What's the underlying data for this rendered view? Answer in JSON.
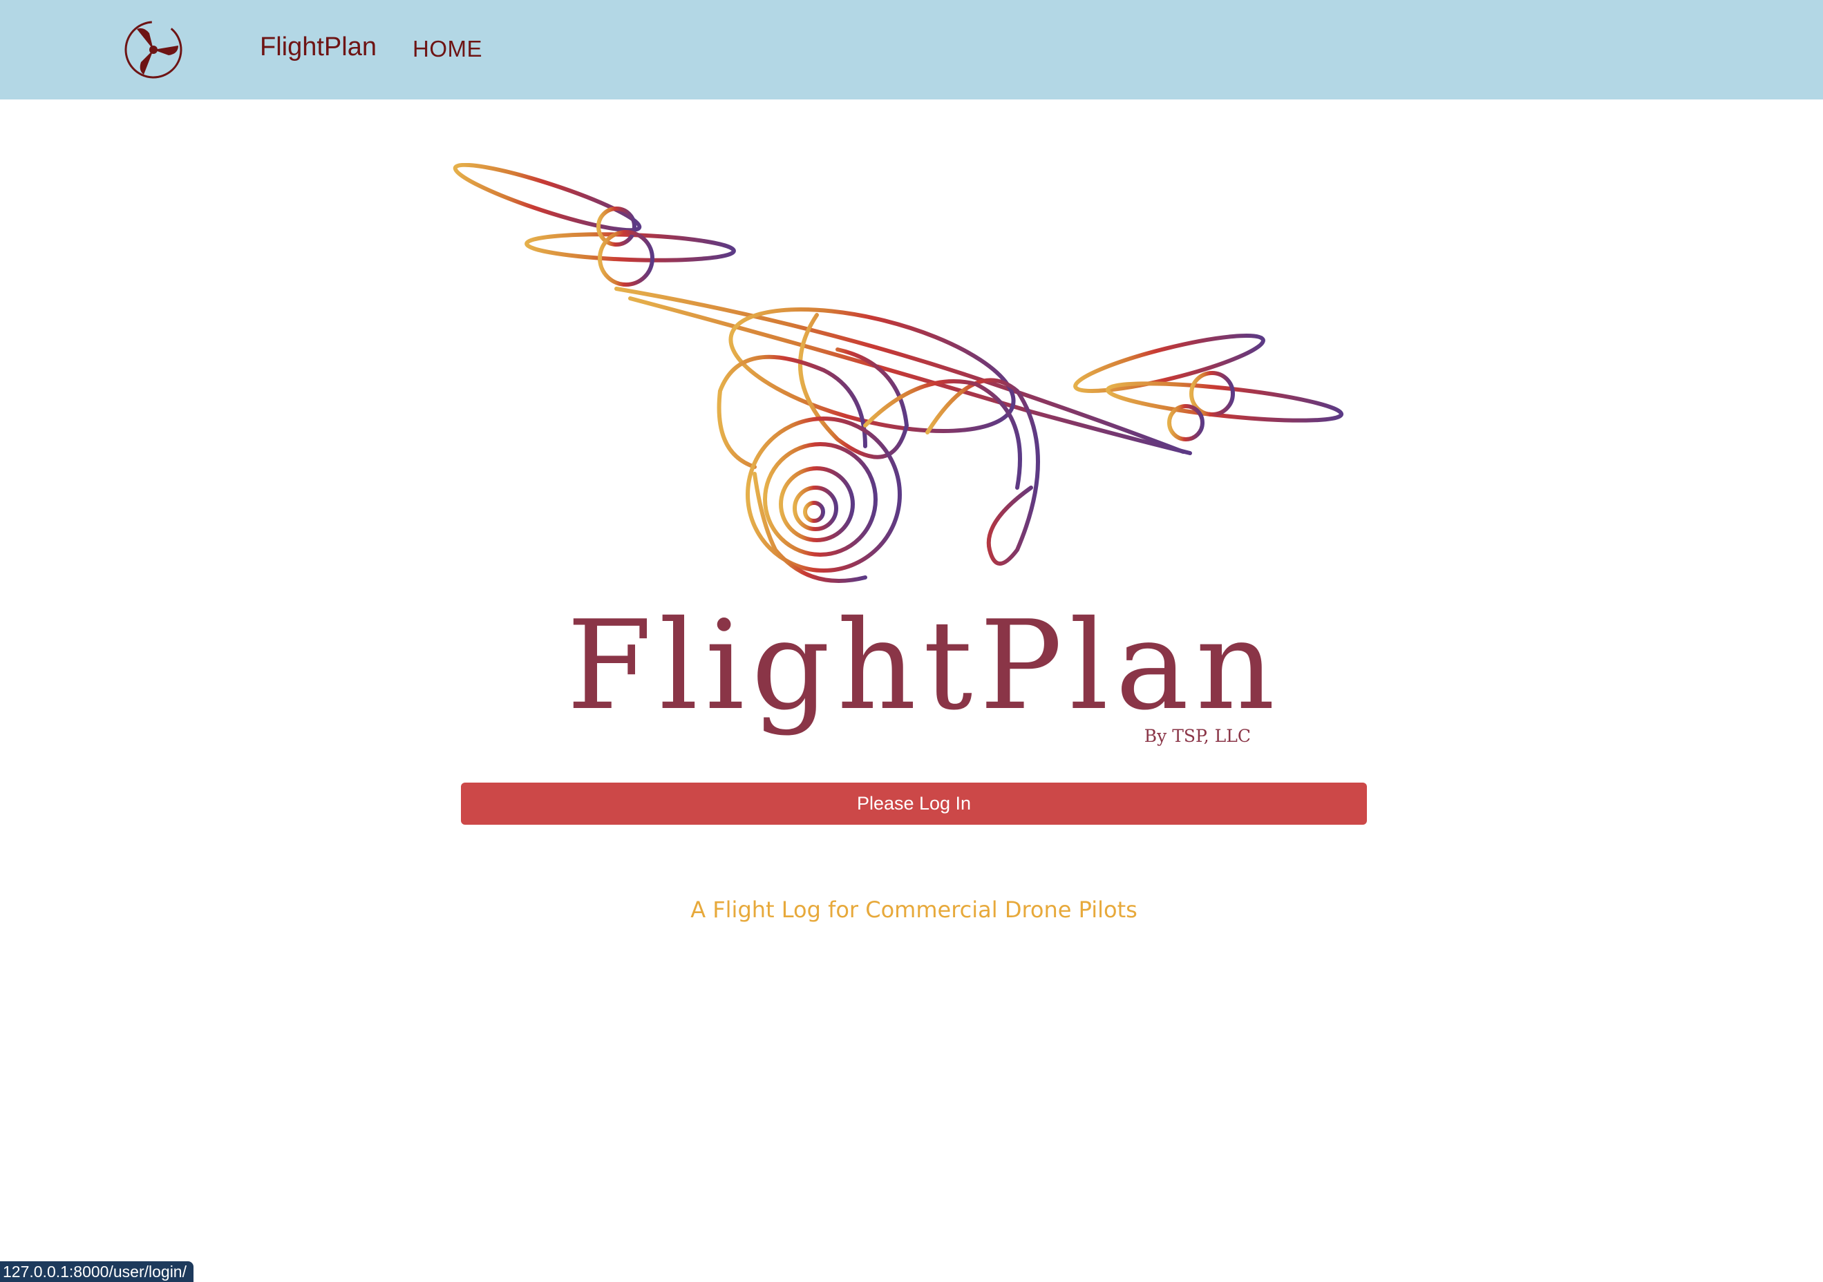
{
  "navbar": {
    "logo_icon": "propeller-icon",
    "brand": "FlightPlan",
    "links": [
      {
        "label": "HOME"
      }
    ],
    "background": "#b3d7e5",
    "text_color": "#6e1414"
  },
  "hero": {
    "illustration_icon": "drone-line-art-icon",
    "title": "FlightPlan",
    "byline": "By TSP, LLC",
    "title_color": "#8a3547"
  },
  "login": {
    "button_label": "Please Log In",
    "button_color": "#cc4848"
  },
  "tagline": {
    "text": "A Flight Log for Commercial Drone Pilots",
    "color": "#e7a93b"
  },
  "status_bar": {
    "url": "127.0.0.1:8000/user/login/"
  }
}
